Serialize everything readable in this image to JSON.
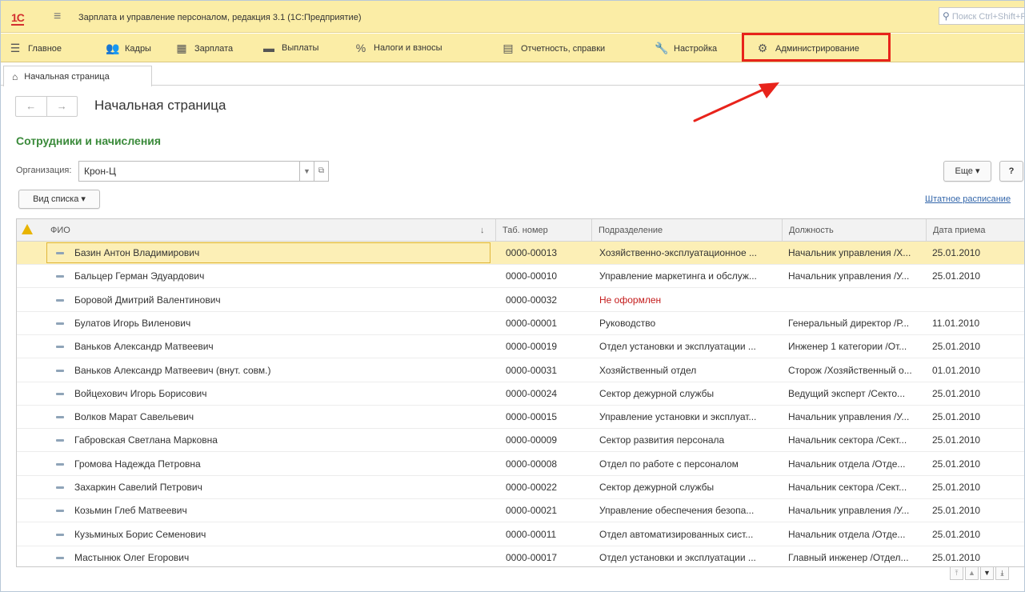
{
  "titlebar": {
    "logo": "1С",
    "title": "Зарплата и управление персоналом, редакция 3.1  (1С:Предприятие)",
    "search_placeholder": "Поиск Ctrl+Shift+F"
  },
  "menu": [
    {
      "label": "Главное",
      "icon": "list-icon"
    },
    {
      "label": "Кадры",
      "icon": "people-icon"
    },
    {
      "label": "Зарплата",
      "icon": "calculator-icon"
    },
    {
      "label": "Выплаты",
      "icon": "wallet-icon"
    },
    {
      "label": "Налоги и взносы",
      "icon": "percent-icon"
    },
    {
      "label": "Отчетность, справки",
      "icon": "report-icon"
    },
    {
      "label": "Настройка",
      "icon": "wrench-icon"
    },
    {
      "label": "Администрирование",
      "icon": "gear-icon"
    }
  ],
  "tab": {
    "label": "Начальная страница"
  },
  "page": {
    "title": "Начальная страница",
    "section": "Сотрудники и начисления"
  },
  "filters": {
    "org_label": "Организация:",
    "org_value": "Крон-Ц"
  },
  "buttons": {
    "list_view": "Вид списка",
    "more": "Еще",
    "help": "?"
  },
  "links": {
    "staffing": "Штатное расписание"
  },
  "table": {
    "columns": [
      "ФИО",
      "Таб. номер",
      "Подразделение",
      "Должность",
      "Дата приема"
    ],
    "rows": [
      {
        "name": "Базин Антон Владимирович",
        "num": "0000-00013",
        "dept": "Хозяйственно-эксплуатационное ...",
        "pos": "Начальник управления /Х...",
        "date": "25.01.2010",
        "selected": true
      },
      {
        "name": "Бальцер Герман Эдуардович",
        "num": "0000-00010",
        "dept": "Управление маркетинга и обслуж...",
        "pos": "Начальник управления /У...",
        "date": "25.01.2010"
      },
      {
        "name": "Боровой Дмитрий Валентинович",
        "num": "0000-00032",
        "dept": "Не оформлен",
        "pos": "",
        "date": "",
        "dept_red": true
      },
      {
        "name": "Булатов Игорь Виленович",
        "num": "0000-00001",
        "dept": "Руководство",
        "pos": "Генеральный директор /Р...",
        "date": "11.01.2010"
      },
      {
        "name": "Ваньков Александр Матвеевич",
        "num": "0000-00019",
        "dept": "Отдел установки и эксплуатации ...",
        "pos": "Инженер 1 категории /От...",
        "date": "25.01.2010"
      },
      {
        "name": "Ваньков Александр Матвеевич (внут. совм.)",
        "num": "0000-00031",
        "dept": "Хозяйственный отдел",
        "pos": "Сторож /Хозяйственный о...",
        "date": "01.01.2010"
      },
      {
        "name": "Войцехович Игорь Борисович",
        "num": "0000-00024",
        "dept": "Сектор дежурной службы",
        "pos": "Ведущий эксперт /Секто...",
        "date": "25.01.2010"
      },
      {
        "name": "Волков Марат Савельевич",
        "num": "0000-00015",
        "dept": "Управление установки и эксплуат...",
        "pos": "Начальник управления /У...",
        "date": "25.01.2010"
      },
      {
        "name": "Габровская Светлана Марковна",
        "num": "0000-00009",
        "dept": "Сектор развития персонала",
        "pos": "Начальник сектора /Сект...",
        "date": "25.01.2010"
      },
      {
        "name": "Громова Надежда Петровна",
        "num": "0000-00008",
        "dept": "Отдел по работе с персоналом",
        "pos": "Начальник отдела /Отде...",
        "date": "25.01.2010"
      },
      {
        "name": "Захаркин Савелий Петрович",
        "num": "0000-00022",
        "dept": "Сектор дежурной службы",
        "pos": "Начальник сектора /Сект...",
        "date": "25.01.2010"
      },
      {
        "name": "Козьмин Глеб Матвеевич",
        "num": "0000-00021",
        "dept": "Управление обеспечения безопа...",
        "pos": "Начальник управления /У...",
        "date": "25.01.2010"
      },
      {
        "name": "Кузьминых Борис Семенович",
        "num": "0000-00011",
        "dept": "Отдел автоматизированных сист...",
        "pos": "Начальник отдела /Отде...",
        "date": "25.01.2010"
      },
      {
        "name": "Мастынюк Олег Егорович",
        "num": "0000-00017",
        "dept": "Отдел установки и эксплуатации ...",
        "pos": "Главный инженер /Отдел...",
        "date": "25.01.2010"
      }
    ]
  },
  "colors": {
    "accent_yellow": "#fbeda6",
    "highlight_red": "#e8231b",
    "section_green": "#3a8a3a",
    "selected_row": "#fcefb6"
  }
}
